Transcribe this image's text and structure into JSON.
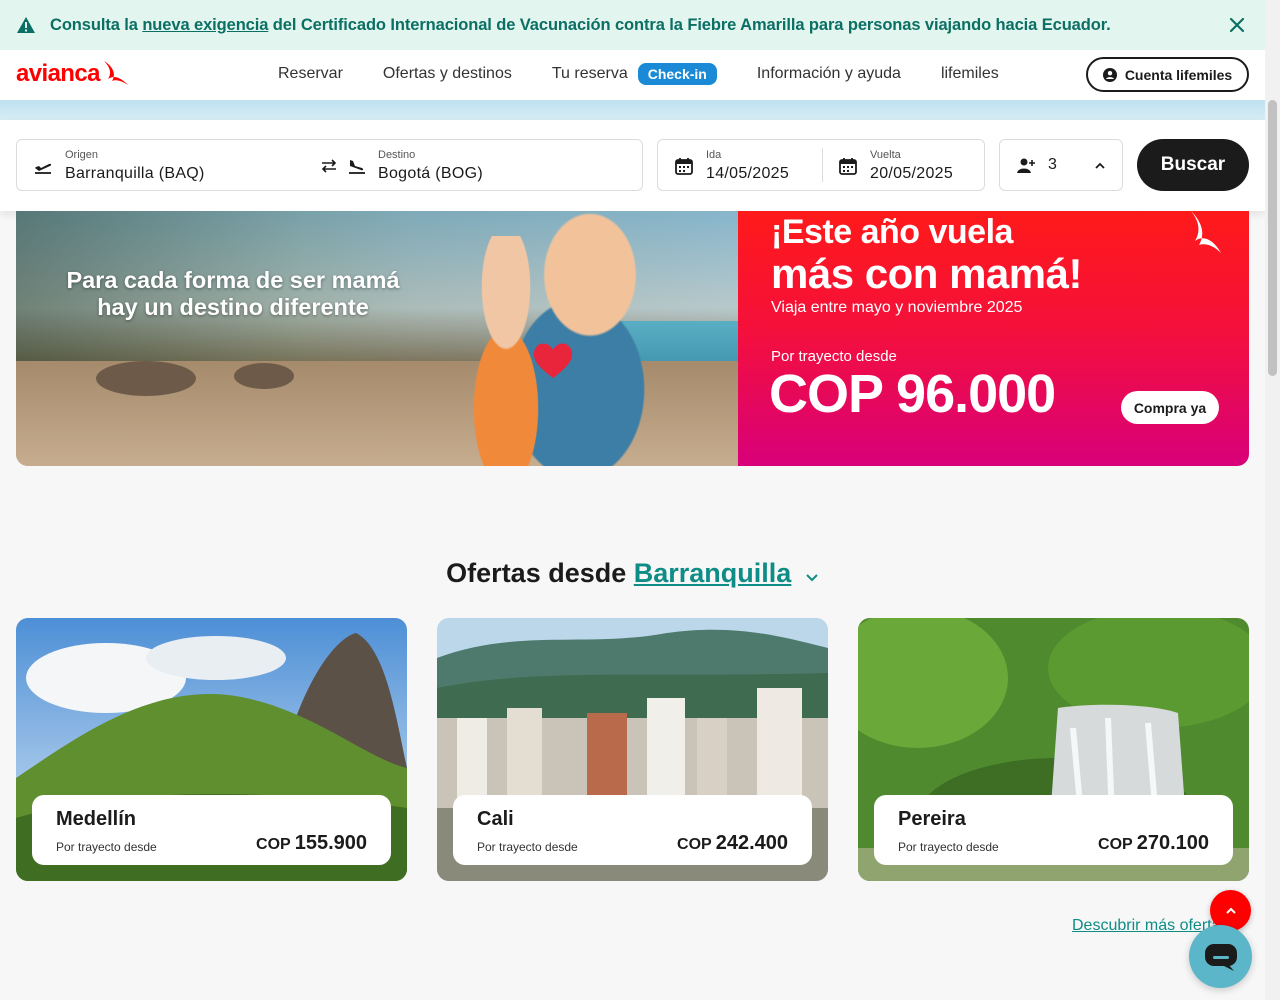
{
  "notice": {
    "prefix": "Consulta la ",
    "link": "nueva exigencia",
    "suffix": " del Certificado Internacional de Vacunación contra la Fiebre Amarilla para personas viajando hacia Ecuador."
  },
  "header": {
    "logo": "avianca",
    "nav": [
      "Reservar",
      "Ofertas y destinos",
      "Tu reserva",
      "Información y ayuda",
      "lifemiles"
    ],
    "checkin_badge": "Check-in",
    "account_button": "Cuenta lifemiles"
  },
  "search": {
    "origin_label": "Origen",
    "origin_value": "Barranquilla (BAQ)",
    "destination_label": "Destino",
    "destination_value": "Bogotá (BOG)",
    "depart_label": "Ida",
    "depart_value": "14/05/2025",
    "return_label": "Vuelta",
    "return_value": "20/05/2025",
    "passengers": "3",
    "search_button": "Buscar"
  },
  "hero": {
    "left_title_1": "Para cada forma de ser mamá",
    "left_title_2": "hay un destino diferente",
    "promo_line1": "¡Este año vuela",
    "promo_line2": "más con mamá!",
    "promo_sub": "Viaja entre mayo y noviembre 2025",
    "promo_from": "Por trayecto desde",
    "promo_price": "COP 96.000",
    "promo_button": "Compra ya"
  },
  "offers": {
    "title": "Ofertas desde",
    "city": "Barranquilla",
    "cards": [
      {
        "name": "Medellín",
        "from": "Por trayecto desde",
        "currency": "COP",
        "price": "155.900"
      },
      {
        "name": "Cali",
        "from": "Por trayecto desde",
        "currency": "COP",
        "price": "242.400"
      },
      {
        "name": "Pereira",
        "from": "Por trayecto desde",
        "currency": "COP",
        "price": "270.100"
      }
    ],
    "discover": "Descubrir más ofertas"
  },
  "colors": {
    "brand_red": "#ff0000",
    "teal": "#0e8c86",
    "checkin_blue": "#1a8ad6",
    "notice_bg": "#e3f5ef"
  },
  "icons": [
    "warning-icon",
    "close-icon",
    "avianca-bird-icon",
    "user-circle-icon",
    "takeoff-icon",
    "swap-icon",
    "landing-icon",
    "calendar-icon",
    "add-person-icon",
    "chevron-up-icon",
    "chevron-down-icon",
    "heart-icon",
    "chat-icon"
  ]
}
